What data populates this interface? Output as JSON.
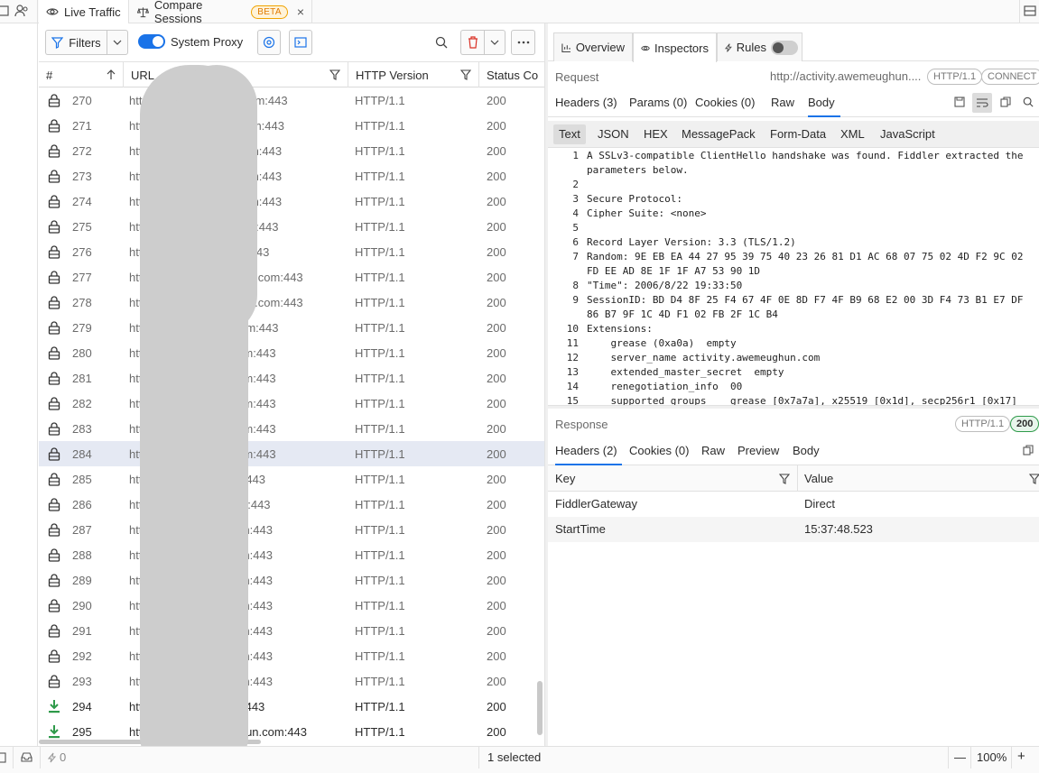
{
  "tabs": [
    {
      "label": "Live Traffic",
      "active": true
    },
    {
      "label": "Compare Sessions",
      "badge": "BETA",
      "close": "×"
    }
  ],
  "toolbar": {
    "filters_label": "Filters",
    "system_proxy_label": "System Proxy",
    "system_proxy_on": true
  },
  "grid": {
    "columns": [
      {
        "label": "#",
        "sort": "asc"
      },
      {
        "label": "URL"
      },
      {
        "label": "HTTP Version"
      },
      {
        "label": "Status Co"
      }
    ],
    "rows": [
      {
        "num": "270",
        "url": "http://secu                    om:443",
        "ver": "HTTP/1.1",
        "status": "200",
        "icon": "lock-icon"
      },
      {
        "num": "271",
        "url": "http://sec                     om:443",
        "ver": "HTTP/1.1",
        "status": "200",
        "icon": "lock-icon"
      },
      {
        "num": "272",
        "url": "http://se                      om:443",
        "ver": "HTTP/1.1",
        "status": "200",
        "icon": "lock-icon"
      },
      {
        "num": "273",
        "url": "http://se                      om:443",
        "ver": "HTTP/1.1",
        "status": "200",
        "icon": "lock-icon"
      },
      {
        "num": "274",
        "url": "http://se                      om:443",
        "ver": "HTTP/1.1",
        "status": "200",
        "icon": "lock-icon"
      },
      {
        "num": "275",
        "url": "http://s                       om:443",
        "ver": "HTTP/1.1",
        "status": "200",
        "icon": "lock-icon"
      },
      {
        "num": "276",
        "url": "http://g                      m:443",
        "ver": "HTTP/1.1",
        "status": "200",
        "icon": "lock-icon"
      },
      {
        "num": "277",
        "url": "http://a                  memv.com:443",
        "ver": "HTTP/1.1",
        "status": "200",
        "icon": "lock-icon"
      },
      {
        "num": "278",
        "url": "http://a                  memv.com:443",
        "ver": "HTTP/1.1",
        "status": "200",
        "icon": "lock-icon"
      },
      {
        "num": "279",
        "url": "http://s                       om:443",
        "ver": "HTTP/1.1",
        "status": "200",
        "icon": "lock-icon"
      },
      {
        "num": "280",
        "url": "http://                        om:443",
        "ver": "HTTP/1.1",
        "status": "200",
        "icon": "lock-icon"
      },
      {
        "num": "281",
        "url": "http://                        om:443",
        "ver": "HTTP/1.1",
        "status": "200",
        "icon": "lock-icon"
      },
      {
        "num": "282",
        "url": "http:/                         om:443",
        "ver": "HTTP/1.1",
        "status": "200",
        "icon": "lock-icon"
      },
      {
        "num": "283",
        "url": "http:                          om:443",
        "ver": "HTTP/1.1",
        "status": "200",
        "icon": "lock-icon"
      },
      {
        "num": "284",
        "url": "http:                          om:443",
        "ver": "HTTP/1.1",
        "status": "200",
        "icon": "lock-icon",
        "selected": true
      },
      {
        "num": "285",
        "url": "http             ghun.com:443",
        "ver": "HTTP/1.1",
        "status": "200",
        "icon": "lock-icon"
      },
      {
        "num": "286",
        "url": "http             memv.com:443",
        "ver": "HTTP/1.1",
        "status": "200",
        "icon": "lock-icon"
      },
      {
        "num": "287",
        "url": "htt                            om:443",
        "ver": "HTTP/1.1",
        "status": "200",
        "icon": "lock-icon"
      },
      {
        "num": "288",
        "url": "htt                            om:443",
        "ver": "HTTP/1.1",
        "status": "200",
        "icon": "lock-icon"
      },
      {
        "num": "289",
        "url": "htt                            om:443",
        "ver": "HTTP/1.1",
        "status": "200",
        "icon": "lock-icon"
      },
      {
        "num": "290",
        "url": "htt                            om:443",
        "ver": "HTTP/1.1",
        "status": "200",
        "icon": "lock-icon"
      },
      {
        "num": "291",
        "url": "htt                            om:443",
        "ver": "HTTP/1.1",
        "status": "200",
        "icon": "lock-icon"
      },
      {
        "num": "292",
        "url": "htt                            om:443",
        "ver": "HTTP/1.1",
        "status": "200",
        "icon": "lock-icon"
      },
      {
        "num": "293",
        "url": "htt                            om:443",
        "ver": "HTTP/1.1",
        "status": "200",
        "icon": "lock-icon"
      },
      {
        "num": "294",
        "url": "htt            zi           om:443",
        "ver": "HTTP/1.1",
        "status": "200",
        "icon": "download-icon",
        "done": true
      },
      {
        "num": "295",
        "url": "http://activity.a             un.com:443",
        "ver": "HTTP/1.1",
        "status": "200",
        "icon": "download-icon",
        "done": true
      }
    ]
  },
  "inspector": {
    "tabs": [
      {
        "label": "Overview",
        "icon": "chart-icon"
      },
      {
        "label": "Inspectors",
        "icon": "eye-icon",
        "active": true
      },
      {
        "label": "Rules",
        "icon": "bolt-icon"
      }
    ],
    "request": {
      "label": "Request",
      "url": "http://activity.awemeughun....",
      "pill_version": "HTTP/1.1",
      "pill_method": "CONNECT",
      "tabs": [
        {
          "label": "Headers (3)"
        },
        {
          "label": "Params (0)"
        },
        {
          "label": "Cookies (0)"
        },
        {
          "label": "Raw"
        },
        {
          "label": "Body",
          "active": true
        }
      ],
      "body_tabs": [
        {
          "label": "Text",
          "active": true
        },
        {
          "label": "JSON"
        },
        {
          "label": "HEX"
        },
        {
          "label": "MessagePack"
        },
        {
          "label": "Form-Data"
        },
        {
          "label": "XML"
        },
        {
          "label": "JavaScript"
        }
      ],
      "lines": [
        {
          "n": "1",
          "t": "A SSLv3-compatible ClientHello handshake was found. Fiddler extracted the"
        },
        {
          "n": "",
          "t": "parameters below."
        },
        {
          "n": "2",
          "t": ""
        },
        {
          "n": "3",
          "t": "Secure Protocol:"
        },
        {
          "n": "4",
          "t": "Cipher Suite: <none>"
        },
        {
          "n": "5",
          "t": ""
        },
        {
          "n": "6",
          "t": "Record Layer Version: 3.3 (TLS/1.2)"
        },
        {
          "n": "7",
          "t": "Random: 9E EB EA 44 27 95 39 75 40 23 26 81 D1 AC 68 07 75 02 4D F2 9C 02"
        },
        {
          "n": "",
          "t": "FD EE AD 8E 1F 1F A7 53 90 1D"
        },
        {
          "n": "8",
          "t": "\"Time\": 2006/8/22 19:33:50"
        },
        {
          "n": "9",
          "t": "SessionID: BD D4 8F 25 F4 67 4F 0E 8D F7 4F B9 68 E2 00 3D F4 73 B1 E7 DF"
        },
        {
          "n": "",
          "t": "86 B7 9F 1C 4D F1 02 FB 2F 1C B4"
        },
        {
          "n": "10",
          "t": "Extensions:"
        },
        {
          "n": "11",
          "t": "    grease (0xa0a)  empty"
        },
        {
          "n": "12",
          "t": "    server_name activity.awemeughun.com"
        },
        {
          "n": "13",
          "t": "    extended_master_secret  empty"
        },
        {
          "n": "14",
          "t": "    renegotiation_info  00"
        },
        {
          "n": "15",
          "t": "    supported_groups    grease [0x7a7a], x25519 [0x1d], secp256r1 [0x17]"
        }
      ]
    },
    "response": {
      "label": "Response",
      "pill_version": "HTTP/1.1",
      "pill_status": "200",
      "tabs": [
        {
          "label": "Headers (2)",
          "active": true
        },
        {
          "label": "Cookies (0)"
        },
        {
          "label": "Raw"
        },
        {
          "label": "Preview"
        },
        {
          "label": "Body"
        }
      ],
      "col_key": "Key",
      "col_value": "Value",
      "headers": [
        {
          "key": "FiddlerGateway",
          "value": "Direct"
        },
        {
          "key": "StartTime",
          "value": "15:37:48.523"
        }
      ]
    }
  },
  "statusbar": {
    "count": "0",
    "selected": "1 selected",
    "zoom": "100%",
    "minus": "—",
    "plus": "+"
  },
  "colors": {
    "accent": "#1a73e8",
    "delete": "#d93025",
    "download": "#2e9a4a",
    "selected_row": "#e5e9f3"
  }
}
